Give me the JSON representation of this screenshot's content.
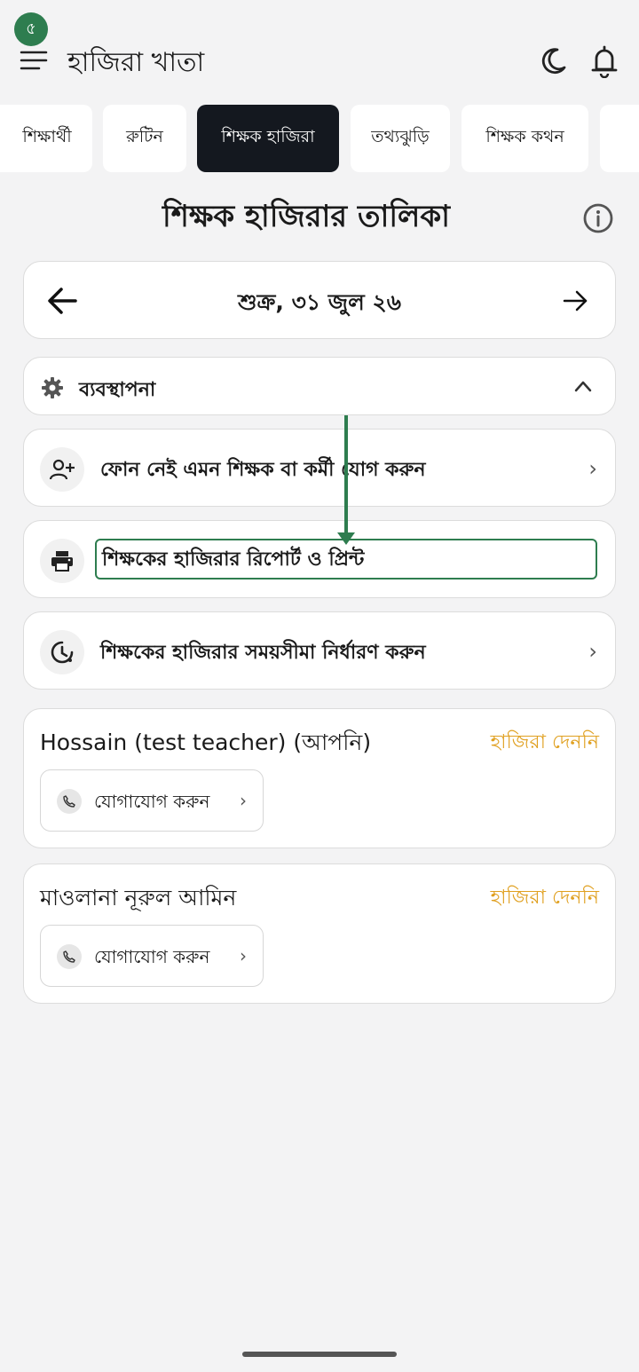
{
  "status": {
    "badge": "৫"
  },
  "header": {
    "title": "হাজিরা খাতা"
  },
  "tabs": [
    {
      "label": "শিক্ষার্থী",
      "active": false
    },
    {
      "label": "রুটিন",
      "active": false
    },
    {
      "label": "শিক্ষক হাজিরা",
      "active": true
    },
    {
      "label": "তথ্যঝুড়ি",
      "active": false
    },
    {
      "label": "শিক্ষক কথন",
      "active": false
    },
    {
      "label": "",
      "active": false
    }
  ],
  "page": {
    "title": "শিক্ষক হাজিরার তালিকা"
  },
  "date_nav": {
    "date": "শুক্র, ৩১ জুল ২৬"
  },
  "management": {
    "label": "ব্যবস্থাপনা"
  },
  "actions": [
    {
      "label": "ফোন নেই এমন শিক্ষক বা কর্মী যোগ করুন",
      "icon": "add-person-icon"
    },
    {
      "label": "শিক্ষকের হাজিরার রিপোর্ট ও প্রিন্ট",
      "icon": "printer-icon"
    },
    {
      "label": "শিক্ষকের হাজিরার সময়সীমা নির্ধারণ করুন",
      "icon": "clock-icon"
    }
  ],
  "chevron": "›",
  "teachers": [
    {
      "name": "Hossain (test teacher) (আপনি)",
      "status": "হাজিরা দেননি",
      "contact_label": "যোগাযোগ করুন"
    },
    {
      "name": "মাওলানা নূরুল আমিন",
      "status": "হাজিরা দেননি",
      "contact_label": "যোগাযোগ করুন"
    }
  ],
  "colors": {
    "accent": "#2e7d4f",
    "status_warning": "#e0a020",
    "active_tab": "#14181f"
  }
}
